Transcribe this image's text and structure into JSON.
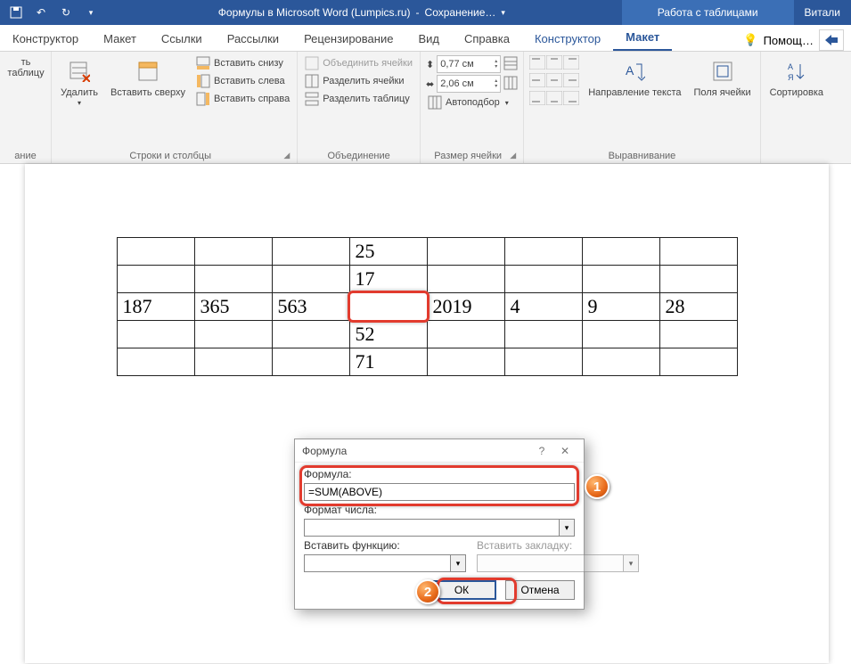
{
  "titlebar": {
    "doc_title": "Формулы в Microsoft Word (Lumpics.ru)",
    "saving": "Сохранение…",
    "context": "Работа с таблицами",
    "user": "Витали"
  },
  "tabs": {
    "items": [
      "Конструктор",
      "Макет",
      "Ссылки",
      "Рассылки",
      "Рецензирование",
      "Вид",
      "Справка",
      "Конструктор",
      "Макет"
    ],
    "help": "Помощ…"
  },
  "ribbon": {
    "draw_group": {
      "draw_table": "ть таблицу",
      "label": "ание"
    },
    "rows_cols": {
      "delete": "Удалить",
      "insert_top": "Вставить сверху",
      "insert_below": "Вставить снизу",
      "insert_left": "Вставить слева",
      "insert_right": "Вставить справа",
      "label": "Строки и столбцы"
    },
    "merge": {
      "merge_cells": "Объединить ячейки",
      "split_cells": "Разделить ячейки",
      "split_table": "Разделить таблицу",
      "label": "Объединение"
    },
    "cell_size": {
      "height": "0,77 см",
      "width": "2,06 см",
      "autofit": "Автоподбор",
      "label": "Размер ячейки"
    },
    "alignment": {
      "text_direction": "Направление текста",
      "cell_margins": "Поля ячейки",
      "label": "Выравнивание"
    },
    "data": {
      "sort": "Сортировка"
    }
  },
  "table": {
    "rows": [
      [
        "",
        "",
        "",
        "25",
        "",
        "",
        "",
        ""
      ],
      [
        "",
        "",
        "",
        "17",
        "",
        "",
        "",
        ""
      ],
      [
        "187",
        "365",
        "563",
        "",
        "2019",
        "4",
        "9",
        "28"
      ],
      [
        "",
        "",
        "",
        "52",
        "",
        "",
        "",
        ""
      ],
      [
        "",
        "",
        "",
        "71",
        "",
        "",
        "",
        ""
      ]
    ]
  },
  "dialog": {
    "title": "Формула",
    "formula_label": "Формула:",
    "formula_value": "=SUM(ABOVE)",
    "format_label": "Формат числа:",
    "function_label": "Вставить функцию:",
    "bookmark_label": "Вставить закладку:",
    "ok": "ОК",
    "cancel": "Отмена"
  },
  "icons": {
    "undo": "↶",
    "redo": "↻",
    "dropdown": "▾",
    "help": "?",
    "close": "✕",
    "up": "▴",
    "down": "▾"
  }
}
